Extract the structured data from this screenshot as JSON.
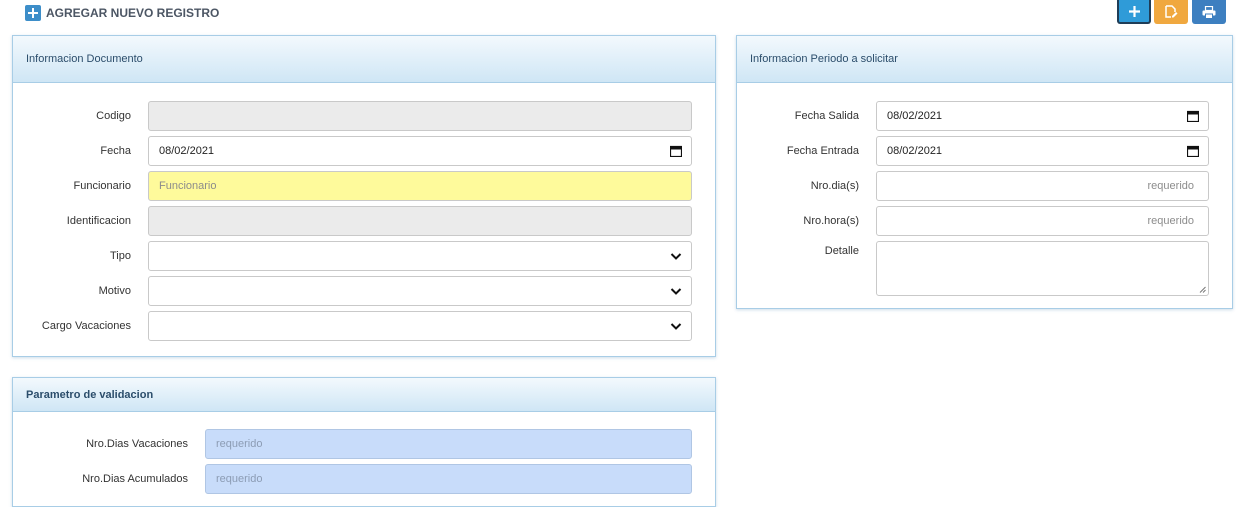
{
  "header": {
    "add_record_label": "AGREGAR NUEVO REGISTRO",
    "buttons": [
      {
        "name": "add",
        "icon": "plus-icon",
        "color": "#2f9bd8"
      },
      {
        "name": "edit",
        "icon": "edit-document-icon",
        "color": "#f0a83f"
      },
      {
        "name": "print",
        "icon": "printer-icon",
        "color": "#3d7fc0"
      }
    ]
  },
  "documento": {
    "title": "Informacion Documento",
    "codigo": {
      "label": "Codigo",
      "value": ""
    },
    "fecha": {
      "label": "Fecha",
      "value": "08/02/2021"
    },
    "funcionario": {
      "label": "Funcionario",
      "placeholder": "Funcionario"
    },
    "identificacion": {
      "label": "Identificacion",
      "value": ""
    },
    "tipo": {
      "label": "Tipo",
      "value": ""
    },
    "motivo": {
      "label": "Motivo",
      "value": ""
    },
    "cargo": {
      "label": "Cargo Vacaciones",
      "value": ""
    }
  },
  "periodo": {
    "title": "Informacion Periodo a solicitar",
    "fecha_salida": {
      "label": "Fecha Salida",
      "value": "08/02/2021"
    },
    "fecha_entrada": {
      "label": "Fecha Entrada",
      "value": "08/02/2021"
    },
    "nro_dias": {
      "label": "Nro.dia(s)",
      "placeholder": "requerido"
    },
    "nro_horas": {
      "label": "Nro.hora(s)",
      "placeholder": "requerido"
    },
    "detalle": {
      "label": "Detalle",
      "value": ""
    }
  },
  "validacion": {
    "title": "Parametro de validacion",
    "dias_vacaciones": {
      "label": "Nro.Dias Vacaciones",
      "placeholder": "requerido"
    },
    "dias_acumulados": {
      "label": "Nro.Dias Acumulados",
      "placeholder": "requerido"
    }
  },
  "colors": {
    "accent": "#3d8ec9",
    "required_field": "#fefa9b",
    "validation_field": "#c8dcfa",
    "panel_border": "#a8cde6"
  }
}
